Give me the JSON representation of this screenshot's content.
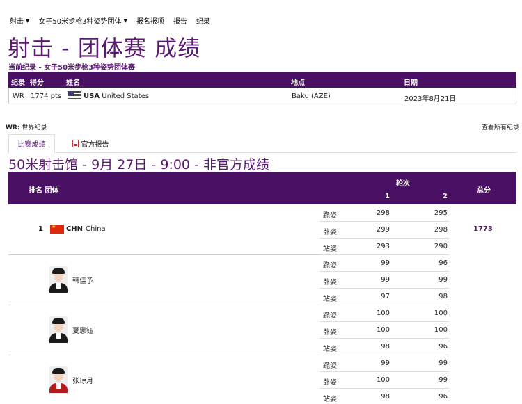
{
  "nav": [
    {
      "label": "射击",
      "caret": true
    },
    {
      "label": "女子50米步枪3种姿势团体",
      "caret": true
    },
    {
      "label": "报名报项",
      "caret": false
    },
    {
      "label": "报告",
      "caret": false
    },
    {
      "label": "纪录",
      "caret": false
    }
  ],
  "page_title": "射击 - 团体赛 成绩",
  "subtitle": "当前纪录 - 女子50米步枪3种姿势团体赛",
  "record_table": {
    "headers": {
      "record": "纪录",
      "score": "得分",
      "name": "姓名",
      "location": "地点",
      "date": "日期"
    },
    "row": {
      "record": "WR",
      "score": "1774 pts",
      "noc": "USA",
      "country": "United States",
      "location": "Baku (AZE)",
      "date": "2023年8月21日"
    }
  },
  "wr_legend": {
    "abbr": "WR:",
    "text": " 世界纪录"
  },
  "all_records_link": "查看所有纪录",
  "tabs": {
    "results": "比赛成绩",
    "report": "官方报告"
  },
  "venue_heading": "50米射击馆 - 9月 27日 - 9:00 - 非官方成绩",
  "results_header": {
    "rank_team": "排名  团体",
    "rounds": "轮次",
    "round1": "1",
    "round2": "2",
    "total": "总分"
  },
  "team": {
    "rank": "1",
    "noc": "CHN",
    "country": "China",
    "total": "1773",
    "rows": [
      {
        "position": "跪姿",
        "r1": "298",
        "r2": "295"
      },
      {
        "position": "卧姿",
        "r1": "299",
        "r2": "298"
      },
      {
        "position": "站姿",
        "r1": "293",
        "r2": "290"
      }
    ]
  },
  "athletes": [
    {
      "name": "韩佳予",
      "rows": [
        {
          "position": "跪姿",
          "r1": "99",
          "r2": "96"
        },
        {
          "position": "卧姿",
          "r1": "99",
          "r2": "99"
        },
        {
          "position": "站姿",
          "r1": "97",
          "r2": "98"
        }
      ]
    },
    {
      "name": "夏思钰",
      "rows": [
        {
          "position": "跪姿",
          "r1": "100",
          "r2": "100"
        },
        {
          "position": "卧姿",
          "r1": "100",
          "r2": "100"
        },
        {
          "position": "站姿",
          "r1": "98",
          "r2": "96"
        }
      ]
    },
    {
      "name": "张琼月",
      "rows": [
        {
          "position": "跪姿",
          "r1": "99",
          "r2": "99"
        },
        {
          "position": "卧姿",
          "r1": "100",
          "r2": "99"
        },
        {
          "position": "站姿",
          "r1": "98",
          "r2": "96"
        }
      ]
    }
  ],
  "colors": {
    "brand": "#4a1063",
    "accent": "#5b1a72"
  }
}
